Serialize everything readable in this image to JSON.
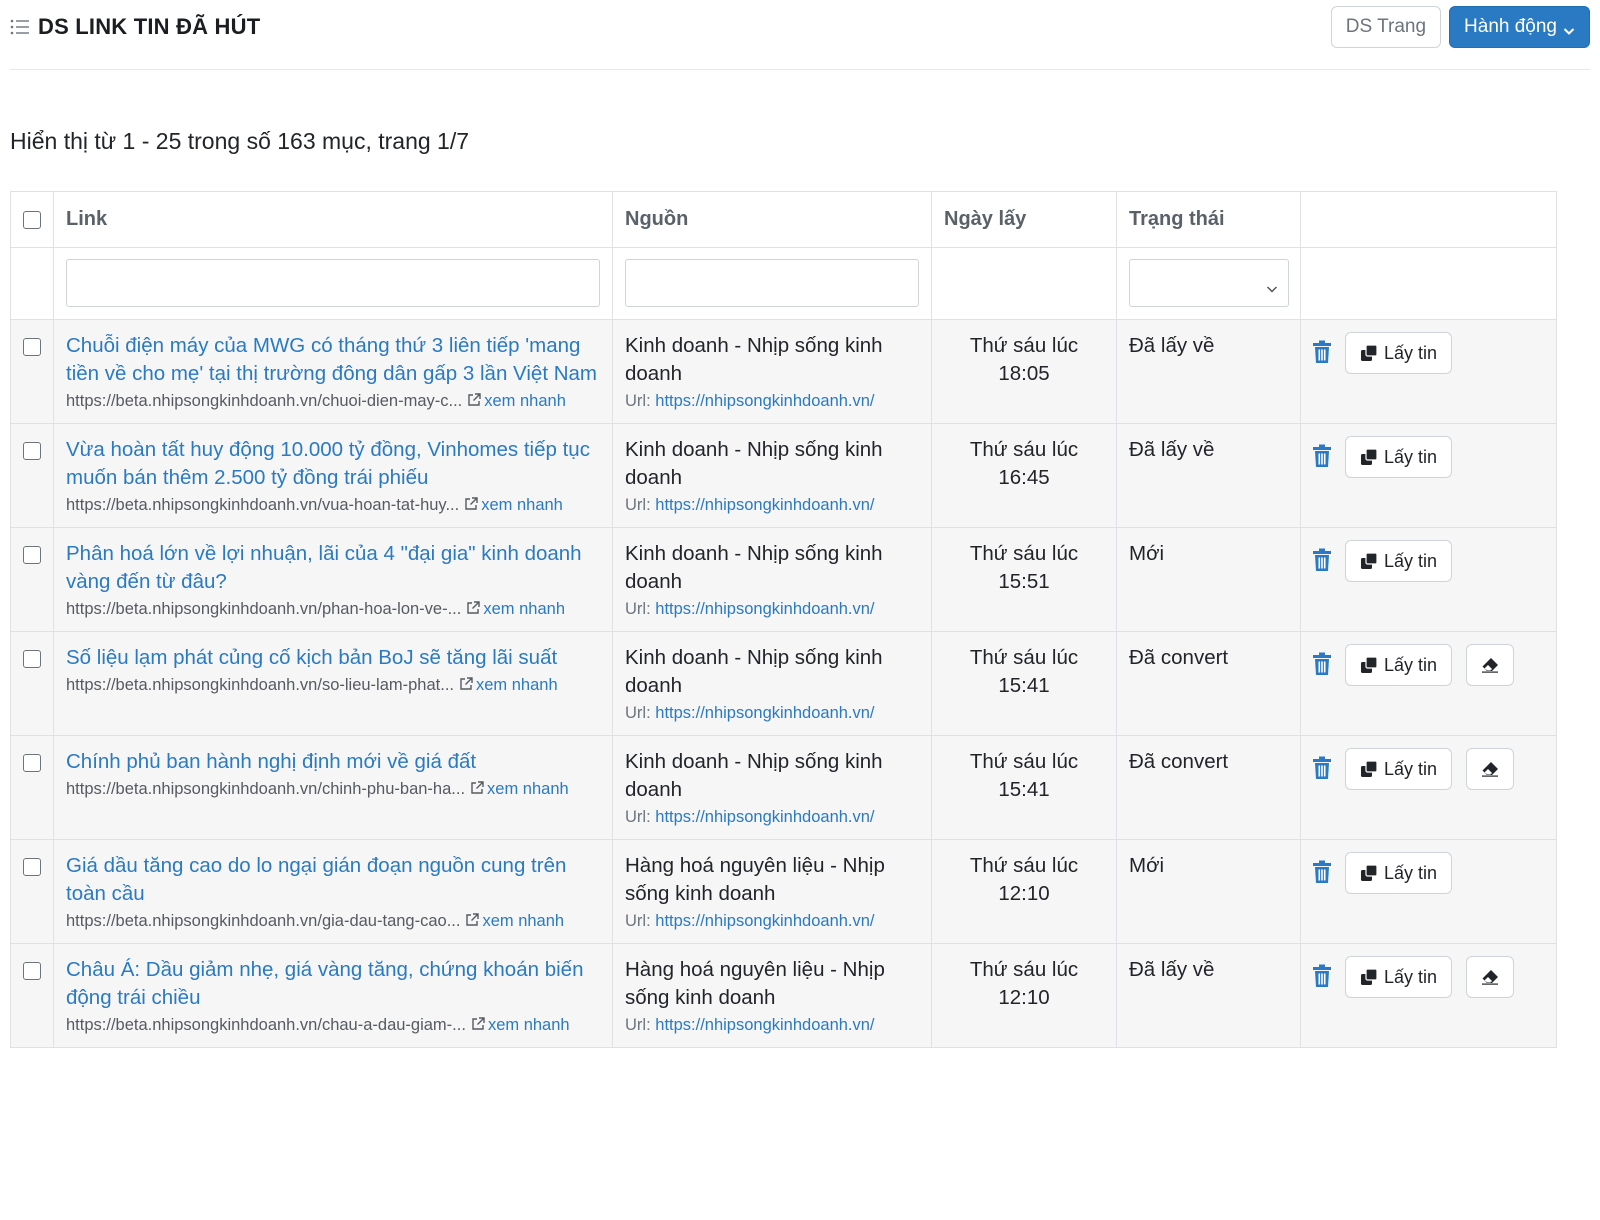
{
  "header": {
    "title": "DS LINK TIN ĐÃ HÚT",
    "btn_pages": "DS Trang",
    "btn_actions": "Hành động"
  },
  "summary": "Hiển thị từ 1 - 25 trong số 163 mục, trang 1/7",
  "table": {
    "columns": [
      "Link",
      "Nguồn",
      "Ngày lấy",
      "Trạng thái"
    ],
    "rows": [
      {
        "title": "Chuỗi điện máy của MWG có tháng thứ 3 liên tiếp 'mang tiền về cho mẹ' tại thị trường đông dân gấp 3 lần Việt Nam",
        "url": "https://beta.nhipsongkinhdoanh.vn/chuoi-dien-may-c...",
        "quick": "xem nhanh",
        "source": "Kinh doanh - Nhịp sống kinh doanh",
        "source_url_label": "Url:",
        "source_url": "https://nhipsongkinhdoanh.vn/",
        "date_line1": "Thứ sáu lúc",
        "date_line2": "18:05",
        "status": "Đã lấy về",
        "fetch_label": "Lấy tin",
        "has_erase": false
      },
      {
        "title": "Vừa hoàn tất huy động 10.000 tỷ đồng, Vinhomes tiếp tục muốn bán thêm 2.500 tỷ đồng trái phiếu",
        "url": "https://beta.nhipsongkinhdoanh.vn/vua-hoan-tat-huy...",
        "quick": "xem nhanh",
        "source": "Kinh doanh - Nhịp sống kinh doanh",
        "source_url_label": "Url:",
        "source_url": "https://nhipsongkinhdoanh.vn/",
        "date_line1": "Thứ sáu lúc",
        "date_line2": "16:45",
        "status": "Đã lấy về",
        "fetch_label": "Lấy tin",
        "has_erase": false
      },
      {
        "title": "Phân hoá lớn về lợi nhuận, lãi của 4 \"đại gia\" kinh doanh vàng đến từ đâu?",
        "url": "https://beta.nhipsongkinhdoanh.vn/phan-hoa-lon-ve-...",
        "quick": "xem nhanh",
        "source": "Kinh doanh - Nhịp sống kinh doanh",
        "source_url_label": "Url:",
        "source_url": "https://nhipsongkinhdoanh.vn/",
        "date_line1": "Thứ sáu lúc",
        "date_line2": "15:51",
        "status": "Mới",
        "fetch_label": "Lấy tin",
        "has_erase": false
      },
      {
        "title": "Số liệu lạm phát củng cố kịch bản BoJ sẽ tăng lãi suất",
        "url": "https://beta.nhipsongkinhdoanh.vn/so-lieu-lam-phat...",
        "quick": "xem nhanh",
        "source": "Kinh doanh - Nhịp sống kinh doanh",
        "source_url_label": "Url:",
        "source_url": "https://nhipsongkinhdoanh.vn/",
        "date_line1": "Thứ sáu lúc",
        "date_line2": "15:41",
        "status": "Đã convert",
        "fetch_label": "Lấy tin",
        "has_erase": true
      },
      {
        "title": "Chính phủ ban hành nghị định mới về giá đất",
        "url": "https://beta.nhipsongkinhdoanh.vn/chinh-phu-ban-ha...",
        "quick": "xem nhanh",
        "source": "Kinh doanh - Nhịp sống kinh doanh",
        "source_url_label": "Url:",
        "source_url": "https://nhipsongkinhdoanh.vn/",
        "date_line1": "Thứ sáu lúc",
        "date_line2": "15:41",
        "status": "Đã convert",
        "fetch_label": "Lấy tin",
        "has_erase": true
      },
      {
        "title": "Giá dầu tăng cao do lo ngại gián đoạn nguồn cung trên toàn cầu",
        "url": "https://beta.nhipsongkinhdoanh.vn/gia-dau-tang-cao...",
        "quick": "xem nhanh",
        "source": "Hàng hoá nguyên liệu - Nhịp sống kinh doanh",
        "source_url_label": "Url:",
        "source_url": "https://nhipsongkinhdoanh.vn/",
        "date_line1": "Thứ sáu lúc",
        "date_line2": "12:10",
        "status": "Mới",
        "fetch_label": "Lấy tin",
        "has_erase": false
      },
      {
        "title": "Châu Á: Dầu giảm nhẹ, giá vàng tăng, chứng khoán biến động trái chiều",
        "url": "https://beta.nhipsongkinhdoanh.vn/chau-a-dau-giam-...",
        "quick": "xem nhanh",
        "source": "Hàng hoá nguyên liệu - Nhịp sống kinh doanh",
        "source_url_label": "Url:",
        "source_url": "https://nhipsongkinhdoanh.vn/",
        "date_line1": "Thứ sáu lúc",
        "date_line2": "12:10",
        "status": "Đã lấy về",
        "fetch_label": "Lấy tin",
        "has_erase": true
      }
    ]
  },
  "colors": {
    "primary": "#2a7ac3",
    "row_bg": "#f6f6f6",
    "border": "#dee2e6"
  },
  "icons": [
    "list-icon",
    "chevron-down-icon",
    "checkbox",
    "external-link-icon",
    "trash-icon",
    "copy-icon",
    "eraser-icon"
  ]
}
